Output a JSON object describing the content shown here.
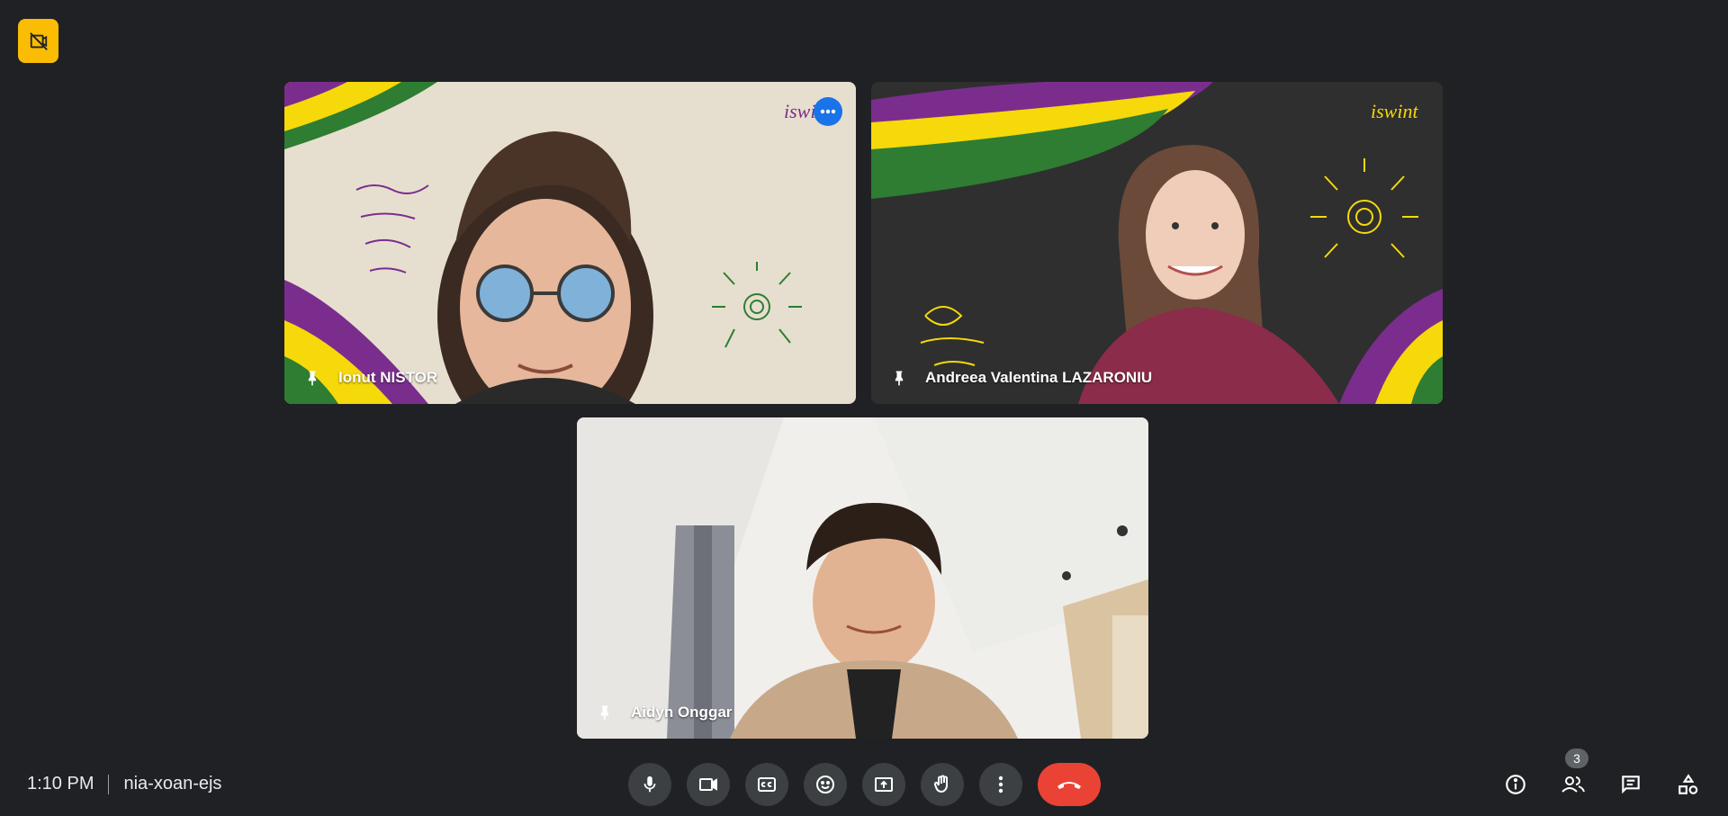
{
  "participants": [
    {
      "name": "Ionut NISTOR"
    },
    {
      "name": "Andreea Valentina LAZARONIU"
    },
    {
      "name": "Aidyn Onggar"
    }
  ],
  "meeting": {
    "time": "1:10 PM",
    "code": "nia-xoan-ejs",
    "people_count": "3"
  },
  "controls": {
    "mic": "microphone-icon",
    "camera": "camera-icon",
    "captions": "captions-icon",
    "reactions": "emoji-icon",
    "present": "present-screen-icon",
    "raise_hand": "raise-hand-icon",
    "more": "more-options-icon",
    "leave": "leave-call-icon"
  },
  "colors": {
    "background": "#202124",
    "control": "#3c4043",
    "leave": "#ea4335",
    "accent_yellow": "#fbbc04",
    "accent_blue": "#1a73e8",
    "brand_purple": "#7b2d8e",
    "brand_yellow": "#f5d90a",
    "brand_green": "#2e7d32"
  }
}
